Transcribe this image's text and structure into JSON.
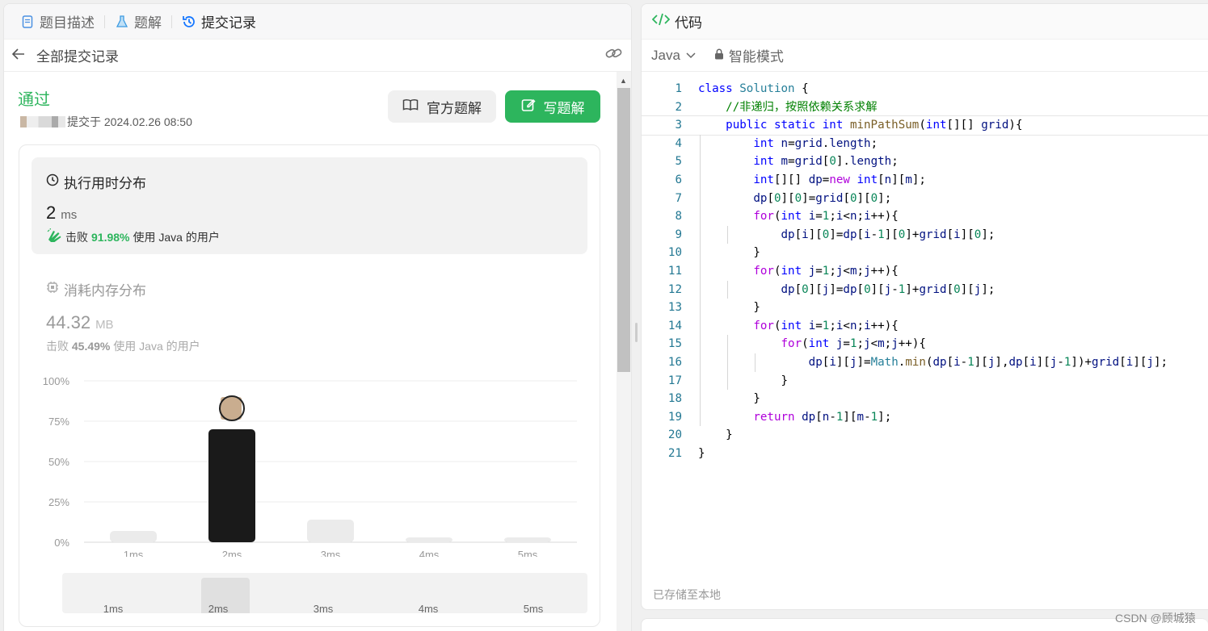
{
  "tabs": [
    {
      "label": "题目描述",
      "icon": "document-icon"
    },
    {
      "label": "题解",
      "icon": "flask-icon"
    },
    {
      "label": "提交记录",
      "icon": "history-icon"
    }
  ],
  "subheader": {
    "title": "全部提交记录"
  },
  "submission": {
    "status": "通过",
    "submitted_text": "提交于 2024.02.26 08:50",
    "btn_official": "官方题解",
    "btn_write": "写题解"
  },
  "runtime": {
    "title": "执行用时分布",
    "value": "2",
    "unit": "ms",
    "beat_prefix": "击败",
    "beat_pct": "91.98%",
    "beat_suffix": "使用 Java 的用户"
  },
  "memory": {
    "title": "消耗内存分布",
    "value": "44.32",
    "unit": "MB",
    "beat_prefix": "击败",
    "beat_pct": "45.49%",
    "beat_suffix": "使用 Java 的用户"
  },
  "chart_data": {
    "type": "bar",
    "categories": [
      "1ms",
      "2ms",
      "3ms",
      "4ms",
      "5ms"
    ],
    "values": [
      7,
      70,
      14,
      3,
      3
    ],
    "highlight": "2ms",
    "ylim": [
      0,
      100
    ],
    "yticks": [
      "0%",
      "25%",
      "50%",
      "75%",
      "100%"
    ],
    "highlight_color": "#1a1a1a",
    "bar_color": "#ebebeb"
  },
  "mini_axis": [
    "1ms",
    "2ms",
    "3ms",
    "4ms",
    "5ms"
  ],
  "code_panel": {
    "title": "代码",
    "language": "Java",
    "mode": "智能模式",
    "saved": "已存储至本地"
  },
  "code_lines": [
    "class Solution {",
    "    //非递归，按照依赖关系求解",
    "    public static int minPathSum(int[][] grid){",
    "        int n=grid.length;",
    "        int m=grid[0].length;",
    "        int[][] dp=new int[n][m];",
    "        dp[0][0]=grid[0][0];",
    "        for(int i=1;i<n;i++){",
    "            dp[i][0]=dp[i-1][0]+grid[i][0];",
    "        }",
    "        for(int j=1;j<m;j++){",
    "            dp[0][j]=dp[0][j-1]+grid[0][j];",
    "        }",
    "        for(int i=1;i<n;i++){",
    "            for(int j=1;j<m;j++){",
    "                dp[i][j]=Math.min(dp[i-1][j],dp[i][j-1])+grid[i][j];",
    "            }",
    "        }",
    "        return dp[n-1][m-1];",
    "    }",
    "}"
  ],
  "watermark": "CSDN @顾城猿"
}
